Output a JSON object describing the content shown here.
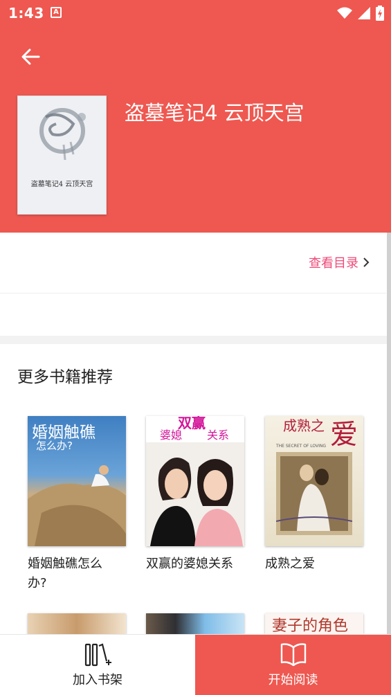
{
  "status_bar": {
    "time": "1:43",
    "notification_glyph": "A"
  },
  "header": {
    "back_icon": "arrow-left-icon",
    "book_title": "盗墓笔记4 云顶天宫",
    "cover_caption": "盗墓笔记4  云顶天宫"
  },
  "toc": {
    "label": "查看目录"
  },
  "recommend": {
    "title": "更多书籍推荐",
    "books": [
      {
        "name": "婚姻触礁怎么办?",
        "cover_title": "婚姻触礁",
        "cover_subtitle": "怎么办?"
      },
      {
        "name": "双赢的婆媳关系",
        "cover_title": "双赢",
        "cover_left": "婆媳",
        "cover_right": "关系"
      },
      {
        "name": "成熟之爱",
        "cover_title": "成熟之",
        "cover_big": "爱",
        "cover_sub": "THE SECRET OF LOVING"
      },
      {
        "name": "",
        "cover_title": ""
      },
      {
        "name": "",
        "cover_title": ""
      },
      {
        "name": "",
        "cover_title": "妻子的角色"
      }
    ]
  },
  "bottom_bar": {
    "shelf_label": "加入书架",
    "read_label": "开始阅读"
  },
  "colors": {
    "brand": "#ee5850",
    "link": "#ee4a78"
  }
}
